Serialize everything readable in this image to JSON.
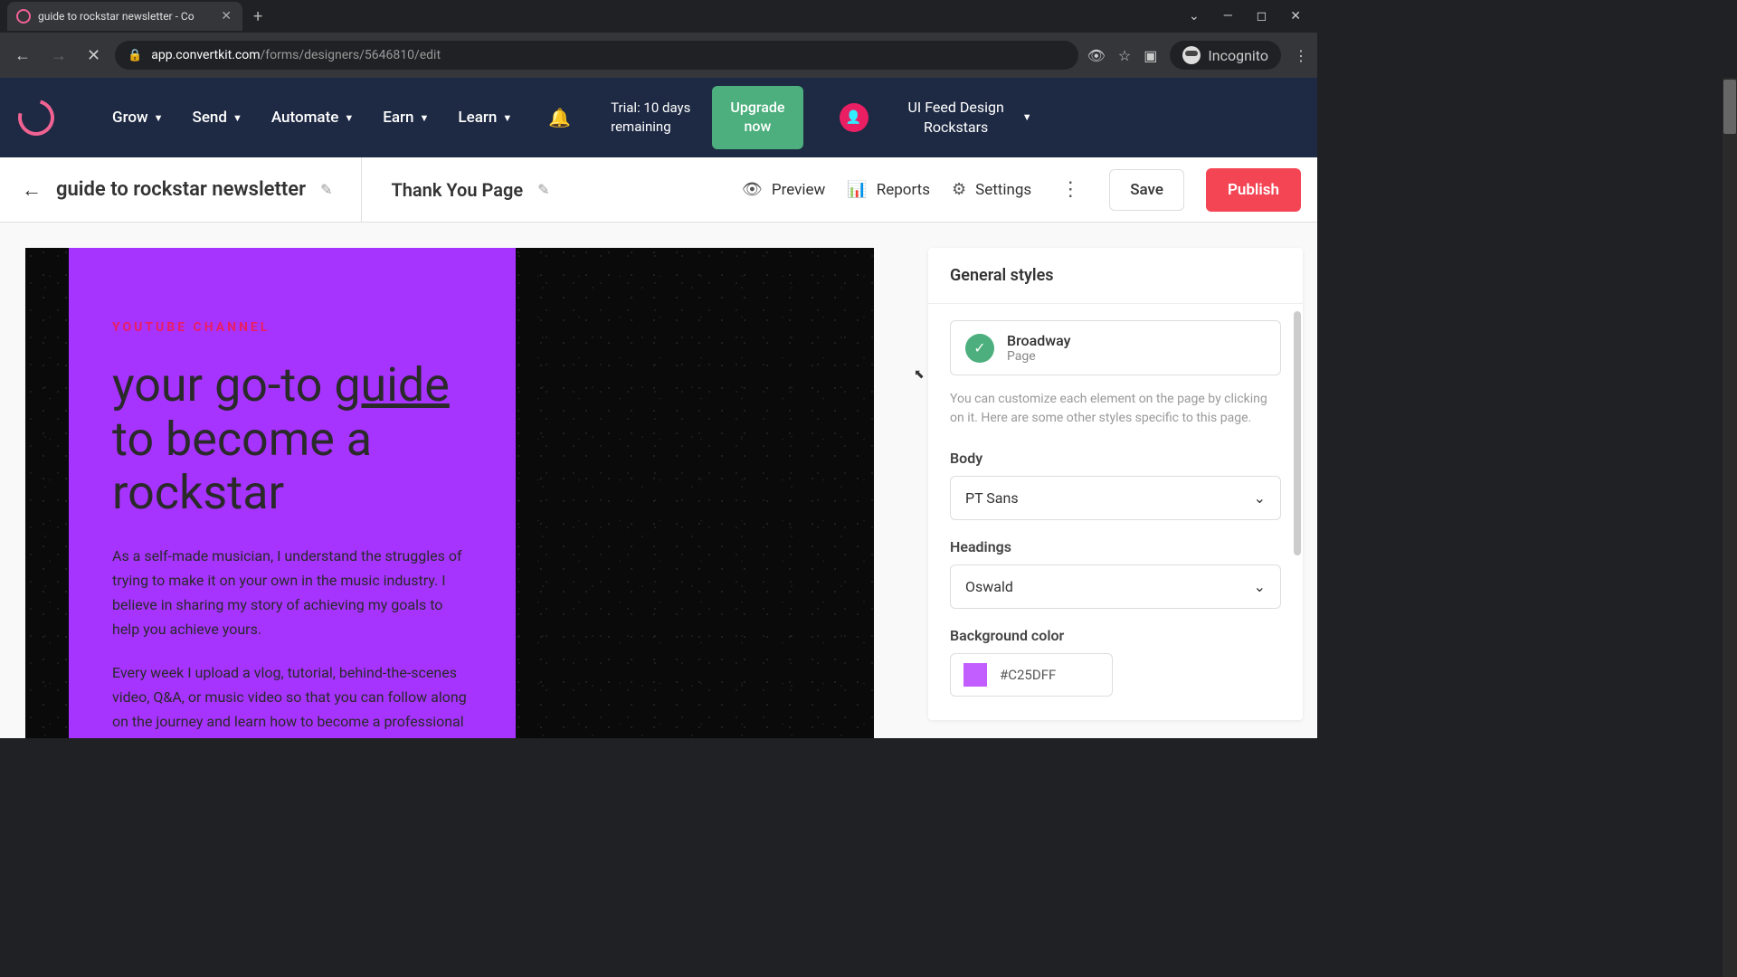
{
  "browser": {
    "tab_title": "guide to rockstar newsletter - Co",
    "url_domain": "app.convertkit.com",
    "url_path": "/forms/designers/5646810/edit",
    "incognito_label": "Incognito"
  },
  "nav": {
    "items": [
      "Grow",
      "Send",
      "Automate",
      "Earn",
      "Learn"
    ],
    "trial_line1": "Trial: 10 days",
    "trial_line2": "remaining",
    "upgrade_line1": "Upgrade",
    "upgrade_line2": "now",
    "account_line1": "UI Feed Design",
    "account_line2": "Rockstars"
  },
  "toolbar": {
    "form_name": "guide to rockstar newsletter",
    "page_name": "Thank You Page",
    "preview": "Preview",
    "reports": "Reports",
    "settings": "Settings",
    "save": "Save",
    "publish": "Publish"
  },
  "canvas": {
    "eyebrow": "YOUTUBE CHANNEL",
    "headline_pre": "your go-to ",
    "headline_under": "guide",
    "headline_post": " to become a rockstar",
    "para1": "As a self-made musician, I understand the struggles of trying to make it on your own in the music industry. I believe in sharing my story of achieving my goals to help you achieve yours.",
    "para2": "Every week I upload a vlog, tutorial, behind-the-scenes video, Q&A, or music video so that you can follow along on the journey and learn how to become a professional music artist too."
  },
  "panel": {
    "title": "General styles",
    "template_name": "Broadway",
    "template_type": "Page",
    "help_text": "You can customize each element on the page by clicking on it. Here are some other styles specific to this page.",
    "body_label": "Body",
    "body_font": "PT Sans",
    "headings_label": "Headings",
    "headings_font": "Oswald",
    "bg_label": "Background color",
    "bg_hex": "#C25DFF"
  }
}
